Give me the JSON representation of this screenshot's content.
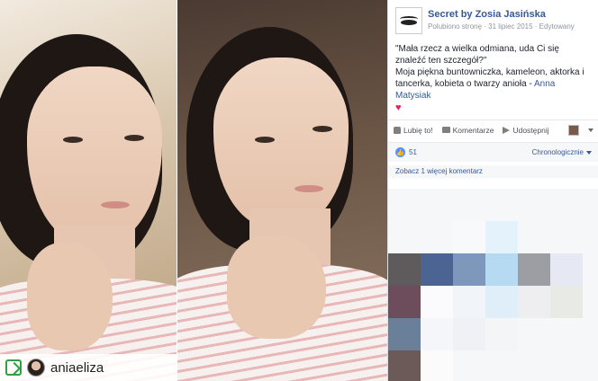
{
  "photo": {
    "repost_handle": "aniaeliza"
  },
  "post": {
    "page_name": "Secret by Zosia Jasińska",
    "meta": {
      "liked_page": "Polubiono stronę",
      "date": "31 lipiec 2015",
      "edited": "Edytowany"
    },
    "text_quote": "\"Mała rzecz a wielka odmiana, uda Ci się znaleźć ten szczegół?\"",
    "text_body": "Moja piękna buntowniczka, kameleon, aktorka i tancerka, kobieta o twarzy anioła - ",
    "mention": "Anna Matysiak",
    "heart": "♥"
  },
  "actions": {
    "like": "Lubię to!",
    "comment": "Komentarze",
    "share": "Udostępnij"
  },
  "reactions": {
    "like_glyph": "👍",
    "count": "51",
    "sort_label": "Chronologicznie"
  },
  "comments": {
    "more_label": "Zobacz 1 więcej komentarz"
  },
  "icons": {
    "repost": "repost-icon",
    "like": "thumbs-up-icon",
    "comment": "comment-icon",
    "share": "share-icon"
  },
  "colors": {
    "link": "#365899",
    "muted": "#90949c",
    "heart": "#e0245e",
    "like_badge": "#5890ff"
  }
}
